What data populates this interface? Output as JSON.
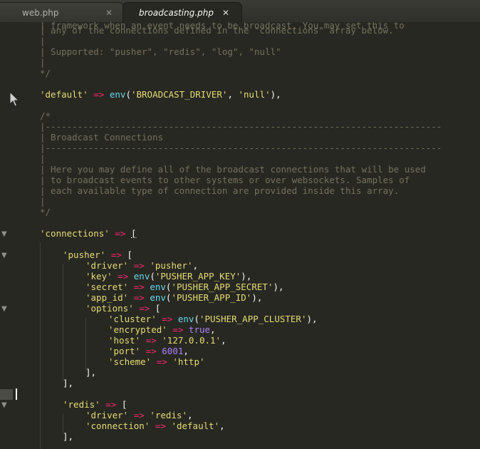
{
  "tabs": [
    {
      "label": "web.php",
      "close": "✕",
      "active": false
    },
    {
      "label": "broadcasting.php",
      "close": "✕",
      "active": true
    }
  ],
  "colors": {
    "background": "#272822",
    "comment": "#75715e",
    "string": "#e6db74",
    "keyword": "#f92672",
    "function": "#66d9ef",
    "number": "#ae81ff"
  },
  "icons": {
    "fold_marker": "triangle-down",
    "pointer": "mouse-pointer"
  },
  "code": {
    "l1": "| framework when an event needs to be broadcast. You may set this to",
    "l2": "| any of the connections defined in the \"connections\" array below.",
    "l3": "|",
    "l4": "| Supported: \"pusher\", \"redis\", \"log\", \"null\"",
    "l5": "|",
    "l6": "*/",
    "l8_key": "'default'",
    "l8_arrow": "=>",
    "l8_fn": "env",
    "l8_open": "(",
    "l8_arg1": "'BROADCAST_DRIVER'",
    "l8_comma": ", ",
    "l8_arg2": "'null'",
    "l8_close": "),",
    "l10": "/*",
    "l11": "|--------------------------------------------------------------------------",
    "l12": "| Broadcast Connections",
    "l13": "|--------------------------------------------------------------------------",
    "l14": "|",
    "l15": "| Here you may define all of the broadcast connections that will be used",
    "l16": "| to broadcast events to other systems or over websockets. Samples of",
    "l17": "| each available type of connection are provided inside this array.",
    "l18": "|",
    "l19": "*/",
    "l21_key": "'connections'",
    "l21_arrow": "=>",
    "l21_open": "[",
    "l23_key": "'pusher'",
    "l23_arrow": "=>",
    "l23_open": "[",
    "l24_key": "'driver'",
    "l24_arrow": "=>",
    "l24_val": "'pusher'",
    "l24_end": ",",
    "l25_key": "'key'",
    "l25_arrow": "=>",
    "l25_fn": "env",
    "l25_arg": "'PUSHER_APP_KEY'",
    "l25_end": "),",
    "l26_key": "'secret'",
    "l26_arrow": "=>",
    "l26_fn": "env",
    "l26_arg": "'PUSHER_APP_SECRET'",
    "l26_end": "),",
    "l27_key": "'app_id'",
    "l27_arrow": "=>",
    "l27_fn": "env",
    "l27_arg": "'PUSHER_APP_ID'",
    "l27_end": "),",
    "l28_key": "'options'",
    "l28_arrow": "=>",
    "l28_open": "[",
    "l29_key": "'cluster'",
    "l29_arrow": "=>",
    "l29_fn": "env",
    "l29_arg": "'PUSHER_APP_CLUSTER'",
    "l29_end": "),",
    "l30_key": "'encrypted'",
    "l30_arrow": "=>",
    "l30_val": "true",
    "l30_end": ",",
    "l31_key": "'host'",
    "l31_arrow": "=>",
    "l31_val": "'127.0.0.1'",
    "l31_end": ",",
    "l32_key": "'port'",
    "l32_arrow": "=>",
    "l32_val": "6001",
    "l32_end": ",",
    "l33_key": "'scheme'",
    "l33_arrow": "=>",
    "l33_val": "'http'",
    "l34": "],",
    "l35": "],",
    "l37_key": "'redis'",
    "l37_arrow": "=>",
    "l37_open": "[",
    "l38_key": "'driver'",
    "l38_arrow": "=>",
    "l38_val": "'redis'",
    "l38_end": ",",
    "l39_key": "'connection'",
    "l39_arrow": "=>",
    "l39_val": "'default'",
    "l39_end": ",",
    "l40": "],"
  }
}
